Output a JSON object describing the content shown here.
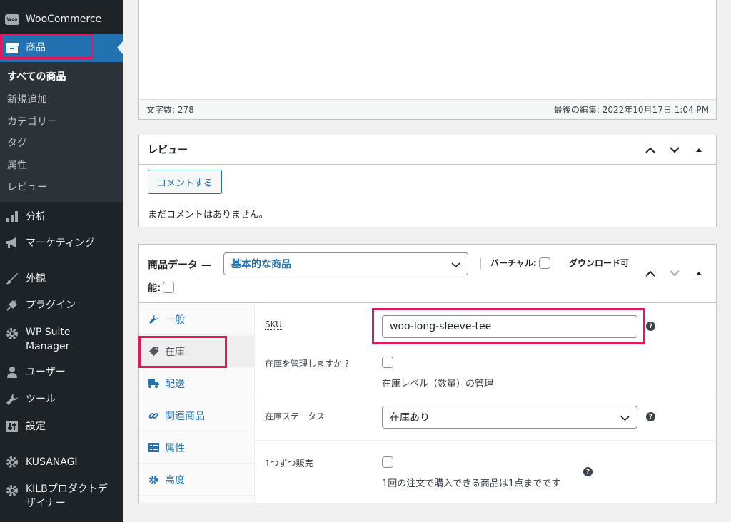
{
  "sidebar": {
    "woocommerce_label": "WooCommerce",
    "woo_logo_text": "Woo",
    "products_label": "商品",
    "submenu": [
      "すべての商品",
      "新規追加",
      "カテゴリー",
      "タグ",
      "属性",
      "レビュー"
    ],
    "items": {
      "analytics": "分析",
      "marketing": "マーケティング",
      "appearance": "外観",
      "plugins": "プラグイン",
      "wpsuite_line1": "WP Suite",
      "wpsuite_line2": "Manager",
      "users": "ユーザー",
      "tools": "ツール",
      "settings": "設定",
      "kusanagi": "KUSANAGI",
      "kilb_line1": "KILBプロダクトデ",
      "kilb_line2": "ザイナー"
    }
  },
  "editor": {
    "word_count": "文字数: 278",
    "last_edited": "最後の編集: 2022年10月17日 1:04 PM"
  },
  "reviews": {
    "title": "レビュー",
    "comment_button": "コメントする",
    "empty": "まだコメントはありません。"
  },
  "product_data": {
    "title": "商品データ —",
    "title_cont": "能:",
    "type_selected": "基本的な商品",
    "virtual_label": "バーチャル:",
    "downloadable_label": "ダウンロード可",
    "tabs": [
      "一般",
      "在庫",
      "配送",
      "関連商品",
      "属性",
      "高度"
    ],
    "sku_label": "SKU",
    "sku_value": "woo-long-sleeve-tee",
    "manage_stock_label": "在庫を管理しますか ?",
    "manage_stock_desc": "在庫レベル（数量）の管理",
    "stock_status_label": "在庫ステータス",
    "stock_status_value": "在庫あり",
    "sold_individually_label": "1つずつ販売",
    "sold_individually_desc": "1回の注文で購入できる商品は1点までです",
    "help_glyph": "?"
  },
  "colors": {
    "sidebar_bg": "#1d2327",
    "accent": "#2271b1",
    "highlight": "#e5175c"
  }
}
